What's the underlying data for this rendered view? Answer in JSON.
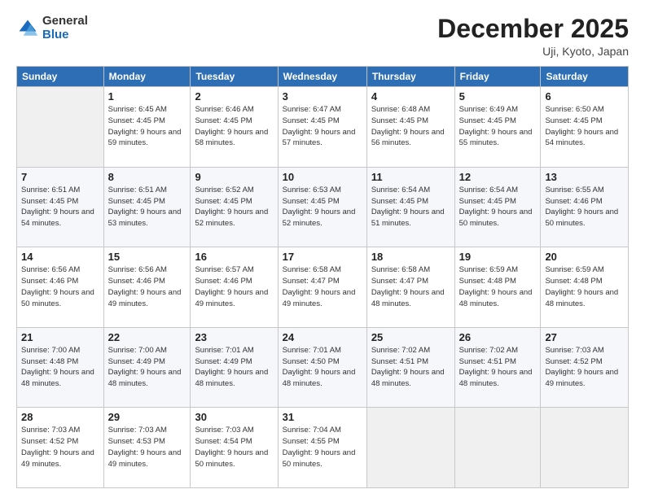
{
  "logo": {
    "general": "General",
    "blue": "Blue"
  },
  "header": {
    "month": "December 2025",
    "location": "Uji, Kyoto, Japan"
  },
  "weekdays": [
    "Sunday",
    "Monday",
    "Tuesday",
    "Wednesday",
    "Thursday",
    "Friday",
    "Saturday"
  ],
  "weeks": [
    [
      {
        "day": "",
        "empty": true
      },
      {
        "day": "1",
        "sunrise": "Sunrise: 6:45 AM",
        "sunset": "Sunset: 4:45 PM",
        "daylight": "Daylight: 9 hours and 59 minutes."
      },
      {
        "day": "2",
        "sunrise": "Sunrise: 6:46 AM",
        "sunset": "Sunset: 4:45 PM",
        "daylight": "Daylight: 9 hours and 58 minutes."
      },
      {
        "day": "3",
        "sunrise": "Sunrise: 6:47 AM",
        "sunset": "Sunset: 4:45 PM",
        "daylight": "Daylight: 9 hours and 57 minutes."
      },
      {
        "day": "4",
        "sunrise": "Sunrise: 6:48 AM",
        "sunset": "Sunset: 4:45 PM",
        "daylight": "Daylight: 9 hours and 56 minutes."
      },
      {
        "day": "5",
        "sunrise": "Sunrise: 6:49 AM",
        "sunset": "Sunset: 4:45 PM",
        "daylight": "Daylight: 9 hours and 55 minutes."
      },
      {
        "day": "6",
        "sunrise": "Sunrise: 6:50 AM",
        "sunset": "Sunset: 4:45 PM",
        "daylight": "Daylight: 9 hours and 54 minutes."
      }
    ],
    [
      {
        "day": "7",
        "sunrise": "Sunrise: 6:51 AM",
        "sunset": "Sunset: 4:45 PM",
        "daylight": "Daylight: 9 hours and 54 minutes."
      },
      {
        "day": "8",
        "sunrise": "Sunrise: 6:51 AM",
        "sunset": "Sunset: 4:45 PM",
        "daylight": "Daylight: 9 hours and 53 minutes."
      },
      {
        "day": "9",
        "sunrise": "Sunrise: 6:52 AM",
        "sunset": "Sunset: 4:45 PM",
        "daylight": "Daylight: 9 hours and 52 minutes."
      },
      {
        "day": "10",
        "sunrise": "Sunrise: 6:53 AM",
        "sunset": "Sunset: 4:45 PM",
        "daylight": "Daylight: 9 hours and 52 minutes."
      },
      {
        "day": "11",
        "sunrise": "Sunrise: 6:54 AM",
        "sunset": "Sunset: 4:45 PM",
        "daylight": "Daylight: 9 hours and 51 minutes."
      },
      {
        "day": "12",
        "sunrise": "Sunrise: 6:54 AM",
        "sunset": "Sunset: 4:45 PM",
        "daylight": "Daylight: 9 hours and 50 minutes."
      },
      {
        "day": "13",
        "sunrise": "Sunrise: 6:55 AM",
        "sunset": "Sunset: 4:46 PM",
        "daylight": "Daylight: 9 hours and 50 minutes."
      }
    ],
    [
      {
        "day": "14",
        "sunrise": "Sunrise: 6:56 AM",
        "sunset": "Sunset: 4:46 PM",
        "daylight": "Daylight: 9 hours and 50 minutes."
      },
      {
        "day": "15",
        "sunrise": "Sunrise: 6:56 AM",
        "sunset": "Sunset: 4:46 PM",
        "daylight": "Daylight: 9 hours and 49 minutes."
      },
      {
        "day": "16",
        "sunrise": "Sunrise: 6:57 AM",
        "sunset": "Sunset: 4:46 PM",
        "daylight": "Daylight: 9 hours and 49 minutes."
      },
      {
        "day": "17",
        "sunrise": "Sunrise: 6:58 AM",
        "sunset": "Sunset: 4:47 PM",
        "daylight": "Daylight: 9 hours and 49 minutes."
      },
      {
        "day": "18",
        "sunrise": "Sunrise: 6:58 AM",
        "sunset": "Sunset: 4:47 PM",
        "daylight": "Daylight: 9 hours and 48 minutes."
      },
      {
        "day": "19",
        "sunrise": "Sunrise: 6:59 AM",
        "sunset": "Sunset: 4:48 PM",
        "daylight": "Daylight: 9 hours and 48 minutes."
      },
      {
        "day": "20",
        "sunrise": "Sunrise: 6:59 AM",
        "sunset": "Sunset: 4:48 PM",
        "daylight": "Daylight: 9 hours and 48 minutes."
      }
    ],
    [
      {
        "day": "21",
        "sunrise": "Sunrise: 7:00 AM",
        "sunset": "Sunset: 4:48 PM",
        "daylight": "Daylight: 9 hours and 48 minutes."
      },
      {
        "day": "22",
        "sunrise": "Sunrise: 7:00 AM",
        "sunset": "Sunset: 4:49 PM",
        "daylight": "Daylight: 9 hours and 48 minutes."
      },
      {
        "day": "23",
        "sunrise": "Sunrise: 7:01 AM",
        "sunset": "Sunset: 4:49 PM",
        "daylight": "Daylight: 9 hours and 48 minutes."
      },
      {
        "day": "24",
        "sunrise": "Sunrise: 7:01 AM",
        "sunset": "Sunset: 4:50 PM",
        "daylight": "Daylight: 9 hours and 48 minutes."
      },
      {
        "day": "25",
        "sunrise": "Sunrise: 7:02 AM",
        "sunset": "Sunset: 4:51 PM",
        "daylight": "Daylight: 9 hours and 48 minutes."
      },
      {
        "day": "26",
        "sunrise": "Sunrise: 7:02 AM",
        "sunset": "Sunset: 4:51 PM",
        "daylight": "Daylight: 9 hours and 48 minutes."
      },
      {
        "day": "27",
        "sunrise": "Sunrise: 7:03 AM",
        "sunset": "Sunset: 4:52 PM",
        "daylight": "Daylight: 9 hours and 49 minutes."
      }
    ],
    [
      {
        "day": "28",
        "sunrise": "Sunrise: 7:03 AM",
        "sunset": "Sunset: 4:52 PM",
        "daylight": "Daylight: 9 hours and 49 minutes."
      },
      {
        "day": "29",
        "sunrise": "Sunrise: 7:03 AM",
        "sunset": "Sunset: 4:53 PM",
        "daylight": "Daylight: 9 hours and 49 minutes."
      },
      {
        "day": "30",
        "sunrise": "Sunrise: 7:03 AM",
        "sunset": "Sunset: 4:54 PM",
        "daylight": "Daylight: 9 hours and 50 minutes."
      },
      {
        "day": "31",
        "sunrise": "Sunrise: 7:04 AM",
        "sunset": "Sunset: 4:55 PM",
        "daylight": "Daylight: 9 hours and 50 minutes."
      },
      {
        "day": "",
        "empty": true
      },
      {
        "day": "",
        "empty": true
      },
      {
        "day": "",
        "empty": true
      }
    ]
  ]
}
